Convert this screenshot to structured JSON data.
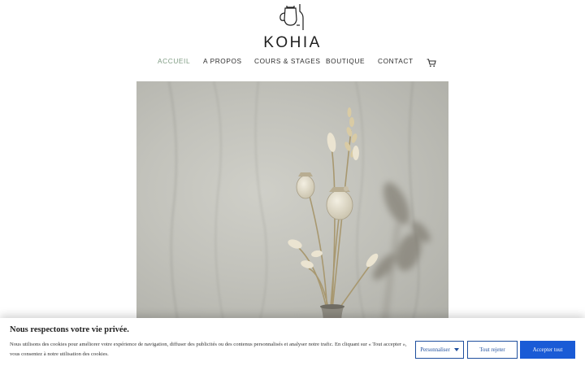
{
  "brand": {
    "name": "KOHIA",
    "logo_icon": "teapot-bottle-logo"
  },
  "nav": {
    "items": [
      {
        "label": "ACCUEIL",
        "active": true
      },
      {
        "label": "A PROPOS",
        "active": false
      },
      {
        "label": "COURS & STAGES",
        "active": false
      },
      {
        "label": "BOUTIQUE",
        "active": false
      },
      {
        "label": "CONTACT",
        "active": false
      }
    ],
    "cart_icon": "cart-icon",
    "active_color": "#7e9b82"
  },
  "hero": {
    "subject": "dried-flowers-vase-photo"
  },
  "cookie_banner": {
    "title": "Nous respectons votre vie privée.",
    "text": "Nous utilisons des cookies pour améliorer votre expérience de navigation, diffuser des publicités ou des contenus personnalisés et analyser notre trafic. En cliquant sur « Tout accepter », vous consentez à notre utilisation des cookies.",
    "customize_label": "Personnaliser",
    "reject_label": "Tout rejeter",
    "accept_label": "Accepter tout",
    "accent_color": "#1a5bd6"
  }
}
